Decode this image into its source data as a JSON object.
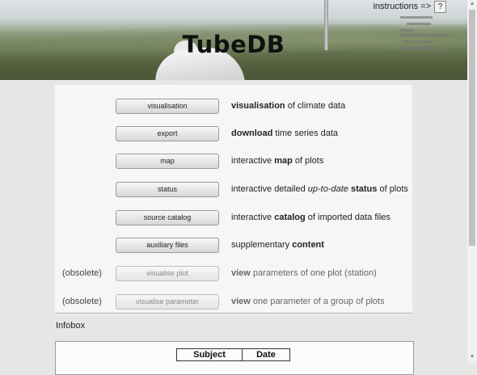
{
  "header": {
    "title": "TubeDB",
    "instructions_label": "instructions =>",
    "help_button": "?"
  },
  "rows": [
    {
      "prefix": "",
      "button": "visualisation",
      "desc_html": "<b>visualisation</b> of climate data",
      "dim": false
    },
    {
      "prefix": "",
      "button": "export",
      "desc_html": "<b>download</b> time series data",
      "dim": false
    },
    {
      "prefix": "",
      "button": "map",
      "desc_html": "interactive <b>map</b> of plots",
      "dim": false
    },
    {
      "prefix": "",
      "button": "status",
      "desc_html": "interactive detailed <i>up-to-date</i> <b>status</b> of plots",
      "dim": false
    },
    {
      "prefix": "",
      "button": "source catalog",
      "desc_html": "interactive <b>catalog</b> of imported data files",
      "dim": false
    },
    {
      "prefix": "",
      "button": "auxiliary files",
      "desc_html": "supplementary <b>content</b>",
      "dim": false
    },
    {
      "prefix": "(obsolete)",
      "button": "visualise plot",
      "desc_html": "<b>view</b> parameters of one plot (station)",
      "dim": true
    },
    {
      "prefix": "(obsolete)",
      "button": "visualise parameter",
      "desc_html": "<b>view</b> one parameter of a group of plots",
      "dim": true
    }
  ],
  "infobox": {
    "label": "Infobox",
    "columns": [
      "Subject",
      "Date"
    ]
  }
}
